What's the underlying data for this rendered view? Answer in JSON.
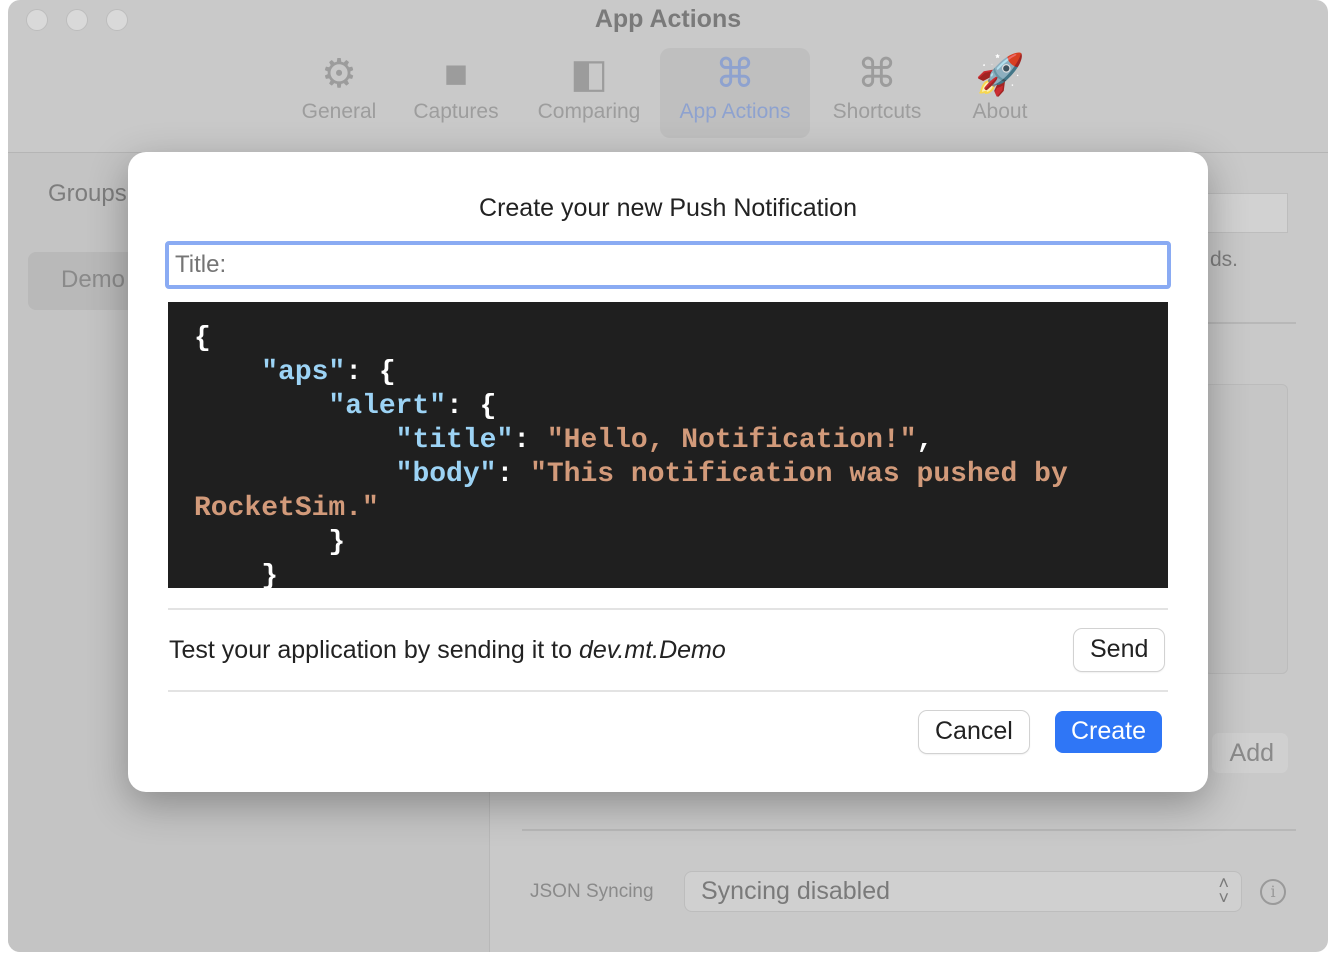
{
  "window": {
    "title": "App Actions"
  },
  "toolbar": [
    {
      "label": "General",
      "icon": "gear-icon",
      "glyph": "⚙"
    },
    {
      "label": "Captures",
      "icon": "video-camera-icon",
      "glyph": "■"
    },
    {
      "label": "Comparing",
      "icon": "split-view-icon",
      "glyph": "◧"
    },
    {
      "label": "App Actions",
      "icon": "command-icon",
      "glyph": "⌘",
      "selected": true
    },
    {
      "label": "Shortcuts",
      "icon": "command-circle-icon",
      "glyph": "⌘"
    },
    {
      "label": "About",
      "icon": "rocket-icon",
      "glyph": "🚀"
    }
  ],
  "background": {
    "groups_label": "Groups",
    "demo_item": "Demo",
    "partial_text": "ds.",
    "add_label": "Add",
    "json_syncing_label": "JSON Syncing",
    "syncing_value": "Syncing disabled"
  },
  "sheet": {
    "title": "Create your new Push Notification",
    "title_placeholder": "Title:",
    "code_lines": [
      [
        [
          "p",
          "{"
        ]
      ],
      [
        [
          "p",
          "    "
        ],
        [
          "k",
          "\"aps\""
        ],
        [
          "p",
          ": {"
        ]
      ],
      [
        [
          "p",
          "        "
        ],
        [
          "k",
          "\"alert\""
        ],
        [
          "p",
          ": {"
        ]
      ],
      [
        [
          "p",
          "            "
        ],
        [
          "k",
          "\"title\""
        ],
        [
          "p",
          ": "
        ],
        [
          "s",
          "\"Hello, Notification!\""
        ],
        [
          "p",
          ","
        ]
      ],
      [
        [
          "p",
          "            "
        ],
        [
          "k",
          "\"body\""
        ],
        [
          "p",
          ": "
        ],
        [
          "s",
          "\"This notification was pushed by"
        ]
      ],
      [
        [
          "s",
          "RocketSim.\""
        ]
      ],
      [
        [
          "p",
          "        }"
        ]
      ],
      [
        [
          "p",
          "    }"
        ]
      ]
    ],
    "test_text": "Test your application by sending it to ",
    "test_target": "dev.mt.Demo",
    "send_label": "Send",
    "cancel_label": "Cancel",
    "create_label": "Create"
  },
  "colors": {
    "accent": "#2f76f6",
    "code_bg": "#1f1f1f",
    "json_key": "#9cd3f5",
    "json_string": "#d29a7a"
  }
}
